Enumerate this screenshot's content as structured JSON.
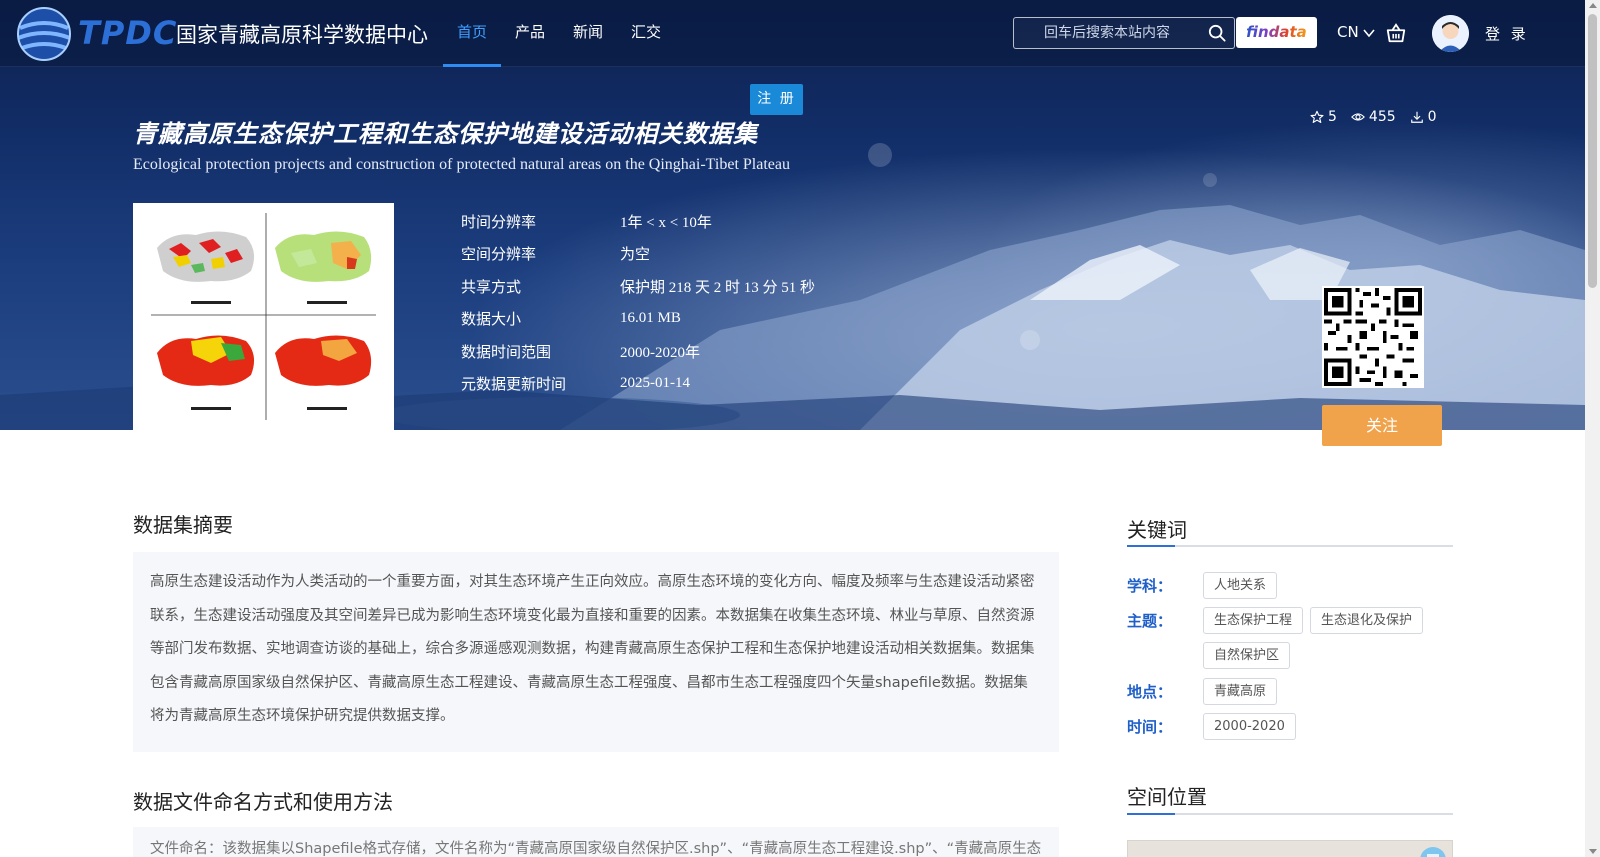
{
  "brand": {
    "abbr": "TPDC",
    "name": "国家青藏高原科学数据中心"
  },
  "nav": {
    "items": [
      {
        "label": "首页",
        "active": true
      },
      {
        "label": "产品",
        "active": false
      },
      {
        "label": "新闻",
        "active": false
      },
      {
        "label": "汇交",
        "active": false
      }
    ]
  },
  "search": {
    "placeholder": "回车后搜索本站内容",
    "value": ""
  },
  "findata": {
    "label": "findata"
  },
  "lang": {
    "label": "CN"
  },
  "user": {
    "login_label": "登 录"
  },
  "register": {
    "label": "注 册"
  },
  "dataset": {
    "title_cn": "青藏高原生态保护工程和生态保护地建设活动相关数据集",
    "title_en": "Ecological protection projects and construction of protected natural areas on the Qinghai-Tibet Plateau",
    "stats": {
      "stars": "5",
      "views": "455",
      "downloads": "0"
    },
    "meta": [
      {
        "key": "时间分辨率",
        "value": "1年 < x < 10年"
      },
      {
        "key": "空间分辨率",
        "value": "为空"
      },
      {
        "key": "共享方式",
        "value": "保护期 218 天 2 时 13 分 51 秒"
      },
      {
        "key": "数据大小",
        "value": "16.01 MB"
      },
      {
        "key": "数据时间范围",
        "value": "2000-2020年"
      },
      {
        "key": "元数据更新时间",
        "value": "2025-01-14"
      }
    ],
    "follow_label": "关注"
  },
  "abstract": {
    "heading": "数据集摘要",
    "text": "高原生态建设活动作为人类活动的一个重要方面，对其生态环境产生正向效应。高原生态环境的变化方向、幅度及频率与生态建设活动紧密联系，生态建设活动强度及其空间差异已成为影响生态环境变化最为直接和重要的因素。本数据集在收集生态环境、林业与草原、自然资源等部门发布数据、实地调查访谈的基础上，综合多源遥感观测数据，构建青藏高原生态保护工程和生态保护地建设活动相关数据集。数据集包含青藏高原国家级自然保护区、青藏高原生态工程建设、青藏高原生态工程强度、昌都市生态工程强度四个矢量shapefile数据。数据集将为青藏高原生态环境保护研究提供数据支撑。"
  },
  "naming": {
    "heading": "数据文件命名方式和使用方法",
    "text": "文件命名：该数据集以Shapefile格式存储，文件名称为“青藏高原国家级自然保护区.shp”、“青藏高原生态工程建设.shp”、“青藏高原生态"
  },
  "keywords": {
    "heading": "关键词",
    "groups": [
      {
        "label": "学科：",
        "tags": [
          "人地关系"
        ]
      },
      {
        "label": "主题：",
        "tags": [
          "生态保护工程",
          "生态退化及保护",
          "自然保护区"
        ]
      },
      {
        "label": "地点：",
        "tags": [
          "青藏高原"
        ]
      },
      {
        "label": "时间：",
        "tags": [
          "2000-2020"
        ]
      }
    ]
  },
  "location": {
    "heading": "空间位置"
  },
  "colors": {
    "accent": "#2f8cf0",
    "follow": "#f0a34a",
    "register": "#1a8ad8",
    "keyword_label": "#1f5fc9"
  }
}
